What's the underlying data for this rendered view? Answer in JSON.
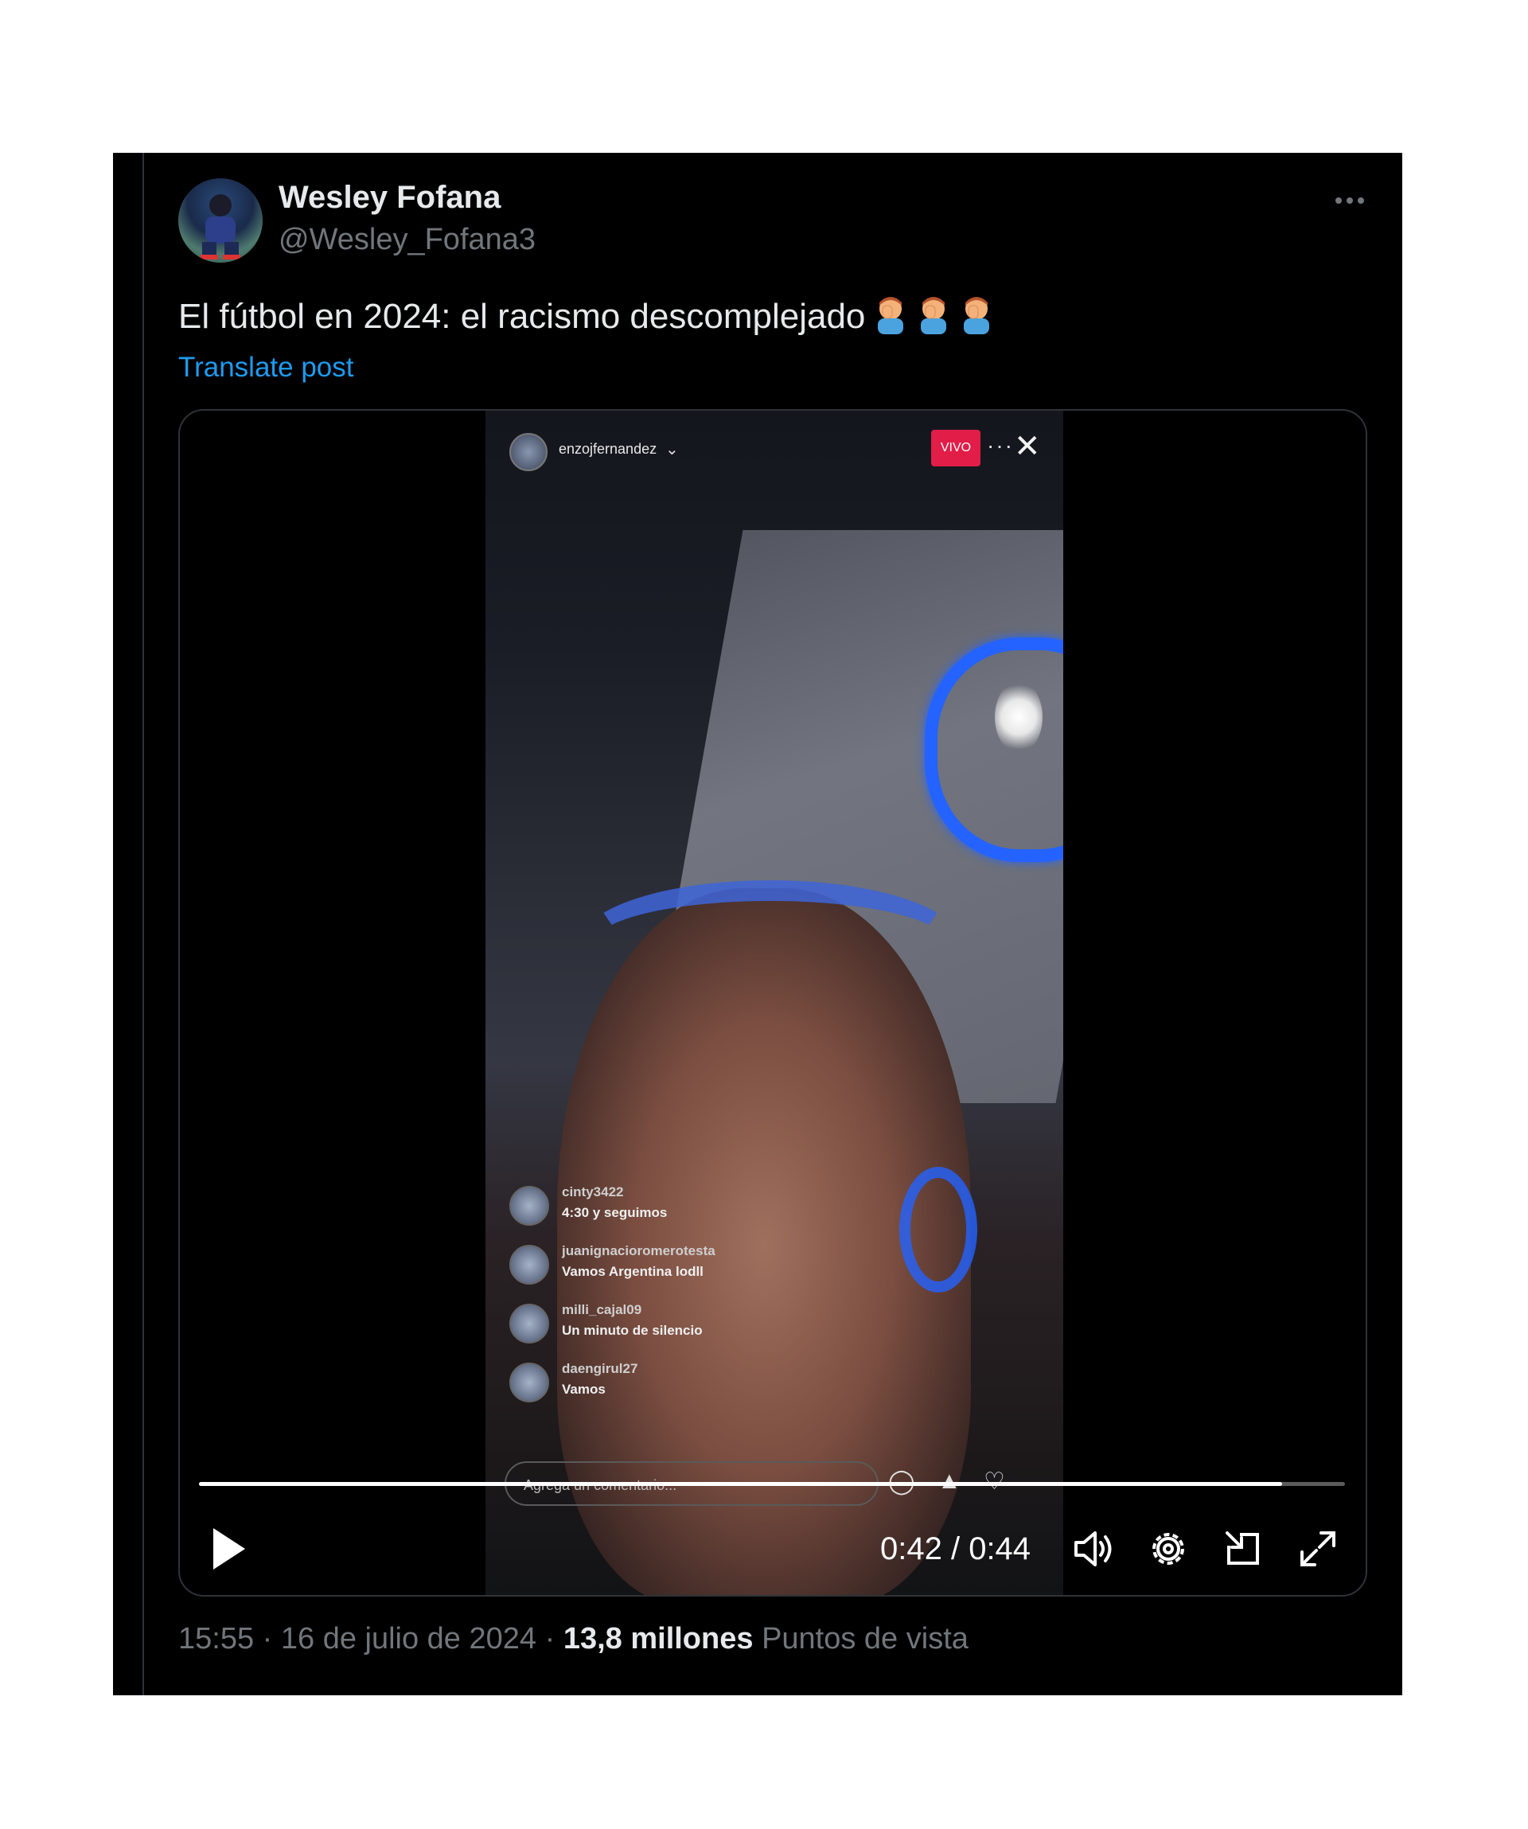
{
  "author": {
    "display_name": "Wesley Fofana",
    "handle": "@Wesley_Fofana3"
  },
  "post": {
    "text": "El fútbol en 2024: el racismo descomplejado",
    "emoji_count": 3,
    "translate_label": "Translate post"
  },
  "video": {
    "instagram": {
      "username": "enzojfernandez",
      "live_badge": "VIVO",
      "comments": [
        {
          "user": "cinty3422",
          "text": "4:30 y seguimos"
        },
        {
          "user": "juanignacioromerotesta",
          "text": "Vamos Argentina lodll"
        },
        {
          "user": "milli_cajal09",
          "text": "Un minuto de silencio"
        },
        {
          "user": "daengirul27",
          "text": "Vamos"
        }
      ],
      "comment_placeholder": "Agrega un comentario..."
    },
    "progress_fraction": 0.945,
    "time_display": "0:42 / 0:44"
  },
  "meta": {
    "time": "15:55",
    "date": "16 de julio de 2024",
    "views_count": "13,8 millones",
    "views_label": "Puntos de vista",
    "separator": "·"
  },
  "icons": {
    "more": "more-horizontal-icon",
    "play": "play-icon",
    "volume": "volume-icon",
    "settings": "gear-icon",
    "pip": "picture-in-picture-icon",
    "fullscreen": "fullscreen-icon"
  },
  "colors": {
    "background": "#000000",
    "link": "#1d9bf0",
    "secondary_text": "#71767b",
    "primary_text": "#e7e9ea",
    "live_badge": "#e11d48"
  }
}
